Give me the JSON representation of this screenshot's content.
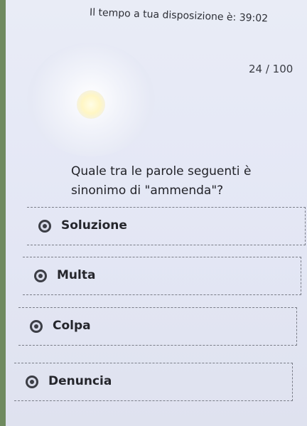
{
  "quiz": {
    "timer_text": "Il tempo a tua disposizione è: 39:02",
    "progress_text": "24 / 100",
    "question": "Quale tra le parole seguenti è sinonimo di \"ammenda\"?",
    "options": [
      {
        "label": "Soluzione"
      },
      {
        "label": "Multa"
      },
      {
        "label": "Colpa"
      },
      {
        "label": "Denuncia"
      }
    ]
  }
}
